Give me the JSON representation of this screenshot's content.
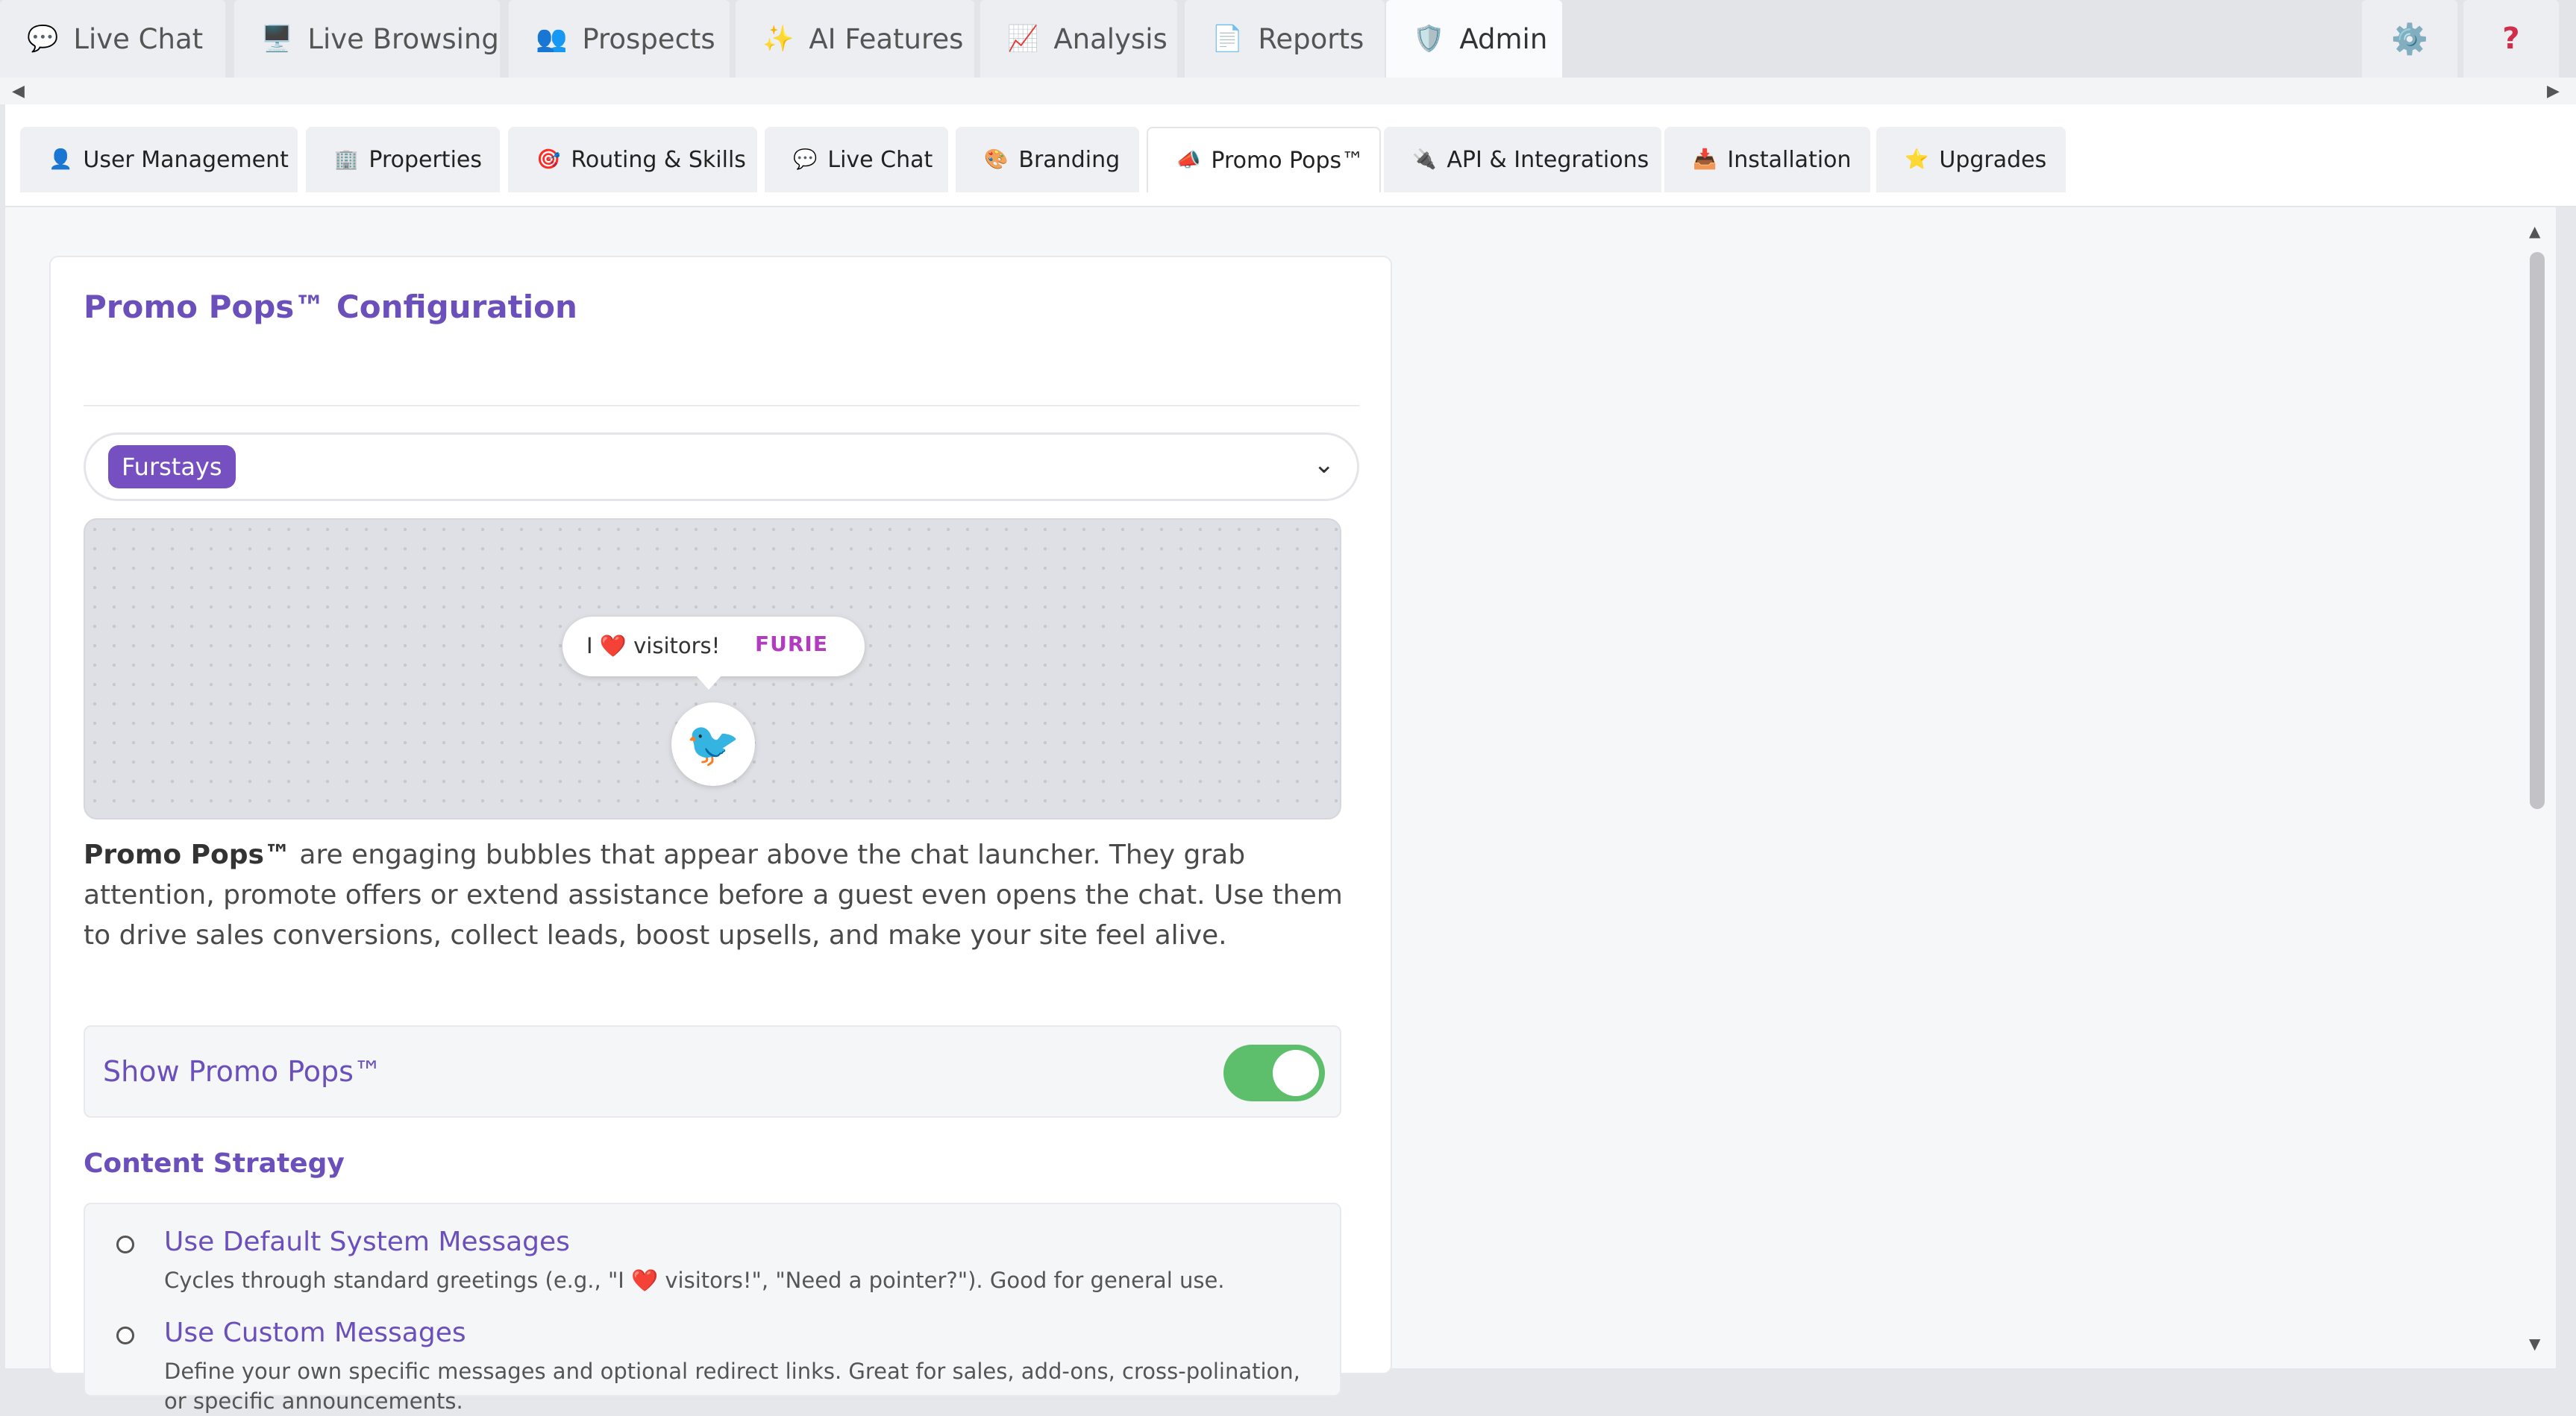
{
  "top_tabs": [
    {
      "label": "Live Chat",
      "icon": "💬"
    },
    {
      "label": "Live Browsing",
      "icon": "🖥️"
    },
    {
      "label": "Prospects",
      "icon": "👥"
    },
    {
      "label": "AI Features",
      "icon": "✨"
    },
    {
      "label": "Analysis",
      "icon": "📈"
    },
    {
      "label": "Reports",
      "icon": "📄"
    },
    {
      "label": "Admin",
      "icon": "🛡️"
    }
  ],
  "top_buttons": {
    "settings_icon": "⚙️",
    "help_icon": "?"
  },
  "sub_tabs": [
    {
      "label": "User Management",
      "icon": "👤"
    },
    {
      "label": "Properties",
      "icon": "🏢"
    },
    {
      "label": "Routing & Skills",
      "icon": "🎯"
    },
    {
      "label": "Live Chat",
      "icon": "💬"
    },
    {
      "label": "Branding",
      "icon": "🎨"
    },
    {
      "label": "Promo Pops™",
      "icon": "📣"
    },
    {
      "label": "API & Integrations",
      "icon": "🔌"
    },
    {
      "label": "Installation",
      "icon": "📥"
    },
    {
      "label": "Upgrades",
      "icon": "⭐"
    }
  ],
  "page": {
    "title": "Promo Pops™ Configuration",
    "property_selected": "Furstays",
    "preview": {
      "bubble_pre": "I",
      "bubble_heart": "❤️",
      "bubble_post": "visitors!",
      "brand_logo": "FURIE",
      "avatar_icon": "🐦"
    },
    "description_bold": "Promo Pops™",
    "description_rest": " are engaging bubbles that appear above the chat launcher. They grab attention, promote offers or extend assistance before a guest even opens the chat. Use them to drive sales conversions, collect leads, boost upsells, and make your site feel alive.",
    "toggle": {
      "label": "Show Promo Pops™",
      "on": true
    },
    "content_strategy": {
      "heading": "Content Strategy",
      "options": [
        {
          "title": "Use Default System Messages",
          "desc": "Cycles through standard greetings (e.g., \"I ❤️ visitors!\", \"Need a pointer?\"). Good for general use."
        },
        {
          "title": "Use Custom Messages",
          "desc": "Define your own specific messages and optional redirect links. Great for sales, add-ons, cross-polination, or specific announcements."
        }
      ]
    }
  },
  "colors": {
    "accent": "#6b4fbb",
    "chip": "#7650c0",
    "toggle_on": "#5dbe6c"
  }
}
